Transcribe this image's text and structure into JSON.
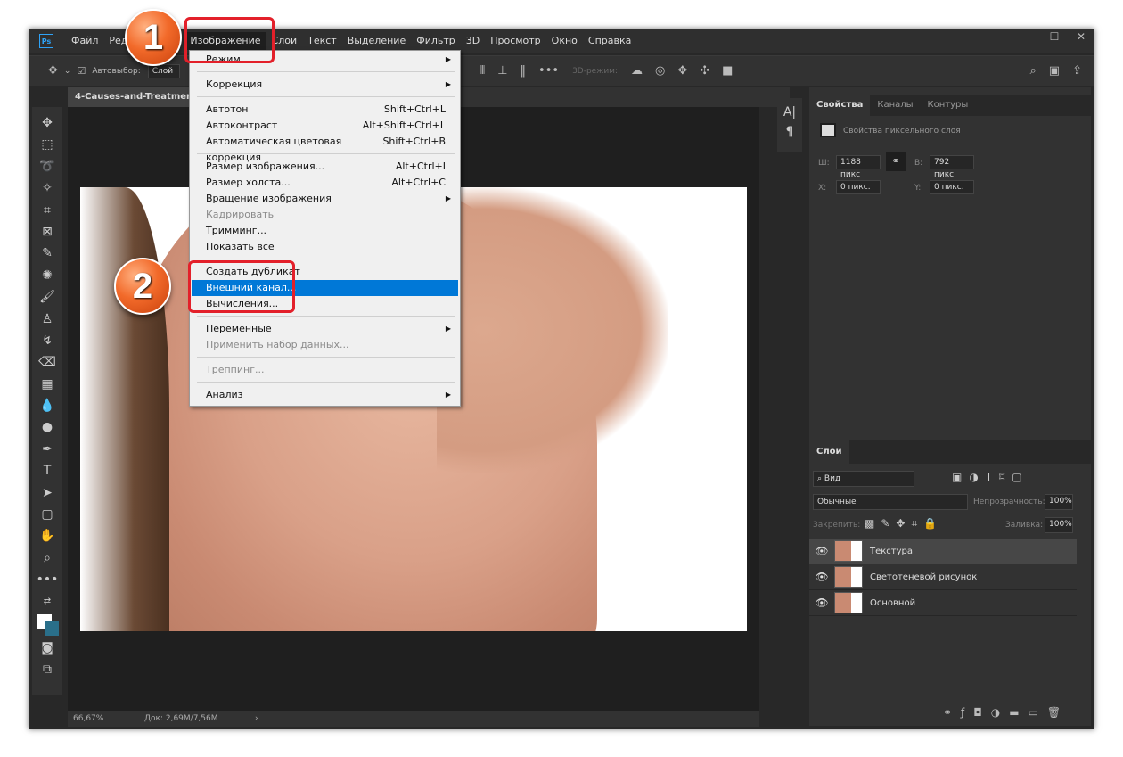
{
  "menubar": {
    "logo": "Ps",
    "items": [
      "Файл",
      "Ред",
      "Изображение",
      "Слои",
      "Текст",
      "Выделение",
      "Фильтр",
      "3D",
      "Просмотр",
      "Окно",
      "Справка"
    ],
    "window_controls": [
      "—",
      "☐",
      "✕"
    ]
  },
  "options": {
    "autoselect": "Автовыбор:",
    "layer_select": "Слой",
    "mode3d": "3D-режим:"
  },
  "document_tab": "4-Causes-and-Treatments-",
  "image_menu": [
    {
      "label": "Режим",
      "submenu": true
    },
    {
      "sep": true
    },
    {
      "label": "Коррекция",
      "submenu": true
    },
    {
      "sep": true
    },
    {
      "label": "Автотон",
      "shortcut": "Shift+Ctrl+L"
    },
    {
      "label": "Автоконтраст",
      "shortcut": "Alt+Shift+Ctrl+L"
    },
    {
      "label": "Автоматическая цветовая коррекция",
      "shortcut": "Shift+Ctrl+B"
    },
    {
      "sep": true
    },
    {
      "label": "Размер изображения...",
      "shortcut": "Alt+Ctrl+I"
    },
    {
      "label": "Размер холста...",
      "shortcut": "Alt+Ctrl+C"
    },
    {
      "label": "Вращение изображения",
      "submenu": true
    },
    {
      "label": "Кадрировать",
      "disabled": true
    },
    {
      "label": "Тримминг..."
    },
    {
      "label": "Показать все"
    },
    {
      "sep": true
    },
    {
      "label": "Создать дубликат"
    },
    {
      "label": "Внешний канал...",
      "highlighted": true
    },
    {
      "label": "Вычисления..."
    },
    {
      "sep": true
    },
    {
      "label": "Переменные",
      "submenu": true
    },
    {
      "label": "Применить набор данных...",
      "disabled": true
    },
    {
      "sep": true
    },
    {
      "label": "Треппинг...",
      "disabled": true
    },
    {
      "sep": true
    },
    {
      "label": "Анализ",
      "submenu": true
    }
  ],
  "callouts": [
    "1",
    "2"
  ],
  "status": {
    "zoom": "66,67%",
    "doc": "Док: 2,69M/7,56M",
    "arrow": "›"
  },
  "properties": {
    "tabs": [
      "Свойства",
      "Каналы",
      "Контуры"
    ],
    "title": "Свойства пиксельного слоя",
    "w_label": "Ш:",
    "w": "1188 пикс",
    "h_label": "В:",
    "h": "792 пикс.",
    "x_label": "X:",
    "x": "0 пикс.",
    "y_label": "Y:",
    "y": "0 пикс."
  },
  "layers": {
    "tab": "Слои",
    "filter": "Вид",
    "blend": "Обычные",
    "opacity_label": "Непрозрачность:",
    "opacity": "100%",
    "lock_label": "Закрепить:",
    "fill_label": "Заливка:",
    "fill": "100%",
    "items": [
      "Текстура",
      "Светотеневой рисунок",
      "Основной"
    ]
  },
  "narrow_panel": [
    "A|",
    "¶"
  ],
  "colors": {
    "accent": "#0078d7",
    "callout": "#f26a2a",
    "highlight_box": "#e3202a"
  }
}
